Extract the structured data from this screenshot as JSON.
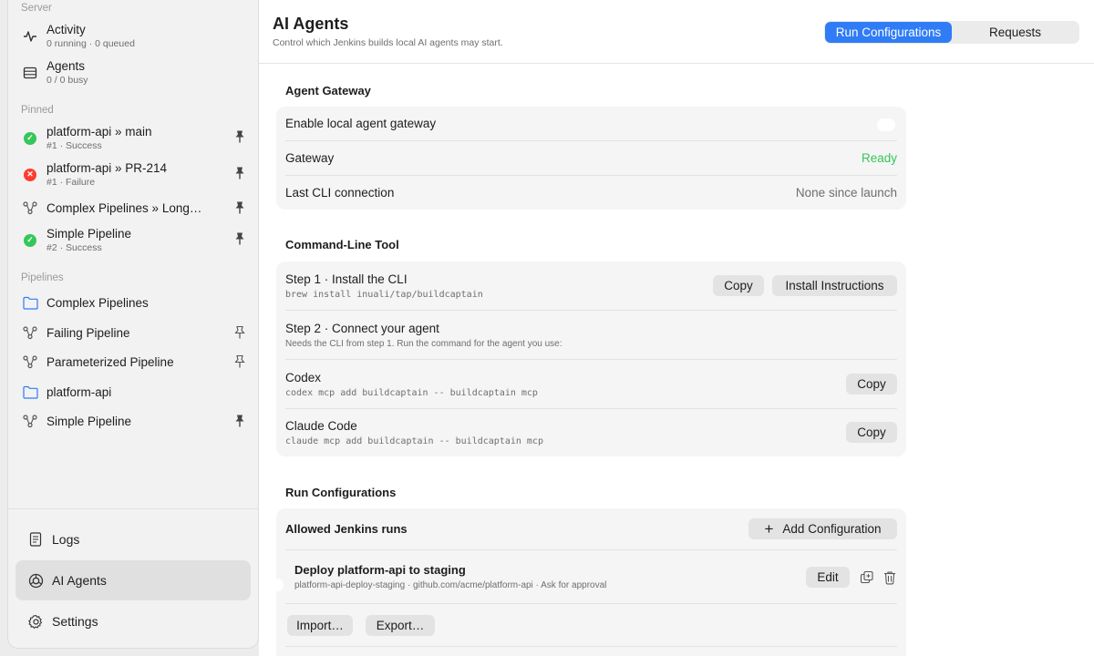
{
  "sidebar": {
    "server_label": "Server",
    "activity": {
      "title": "Activity",
      "detail": "0 running · 0 queued"
    },
    "agents": {
      "title": "Agents",
      "detail": "0 / 0 busy"
    },
    "pinned_label": "Pinned",
    "pinned": [
      {
        "title": "platform-api » main",
        "detail": "#1 · Success",
        "status": "success"
      },
      {
        "title": "platform-api » PR-214",
        "detail": "#1 · Failure",
        "status": "failure"
      },
      {
        "title": "Complex Pipelines » Long…",
        "detail": "",
        "status": "pipeline"
      },
      {
        "title": "Simple Pipeline",
        "detail": "#2 · Success",
        "status": "success"
      }
    ],
    "pipelines_label": "Pipelines",
    "pipelines": [
      {
        "title": "Complex Pipelines",
        "icon": "folder-icon"
      },
      {
        "title": "Failing Pipeline",
        "icon": "pipeline-icon"
      },
      {
        "title": "Parameterized Pipeline",
        "icon": "pipeline-icon"
      },
      {
        "title": "platform-api",
        "icon": "folder-icon"
      },
      {
        "title": "Simple Pipeline",
        "icon": "pipeline-icon"
      }
    ],
    "bottom": [
      {
        "label": "Logs",
        "icon": "document-icon"
      },
      {
        "label": "AI Agents",
        "icon": "ai-agent-icon"
      },
      {
        "label": "Settings",
        "icon": "gear-icon"
      }
    ]
  },
  "header": {
    "title": "AI Agents",
    "subtitle": "Control which Jenkins builds local AI agents may start.",
    "tabs": [
      "Run Configurations",
      "Requests"
    ],
    "selected_tab": "Run Configurations"
  },
  "gateway": {
    "heading": "Agent Gateway",
    "enable_label": "Enable local agent gateway",
    "enabled": true,
    "gateway_label": "Gateway",
    "gateway_status": "Ready",
    "last_cli_label": "Last CLI connection",
    "last_cli_value": "None since launch"
  },
  "cli": {
    "heading": "Command-Line Tool",
    "step1_title": "Step 1 · Install the CLI",
    "step1_cmd": "brew install inuali/tap/buildcaptain",
    "copy_label": "Copy",
    "install_instructions_label": "Install Instructions",
    "step2_title": "Step 2 · Connect your agent",
    "step2_note": "Needs the CLI from step 1. Run the command for the agent you use:",
    "codex_title": "Codex",
    "codex_cmd": "codex mcp add buildcaptain -- buildcaptain mcp",
    "claude_title": "Claude Code",
    "claude_cmd": "claude mcp add buildcaptain -- buildcaptain mcp"
  },
  "runconfig": {
    "heading": "Run Configurations",
    "allowed_label": "Allowed Jenkins runs",
    "add_label": "Add Configuration",
    "item_title": "Deploy platform-api to staging",
    "item_detail": "platform-api-deploy-staging · github.com/acme/platform-api · Ask for approval",
    "item_enabled": true,
    "edit_label": "Edit",
    "import_label": "Import…",
    "export_label": "Export…"
  },
  "colors": {
    "accent": "#2f7cf6",
    "ready": "#34c759",
    "failure": "#ff3b30"
  }
}
